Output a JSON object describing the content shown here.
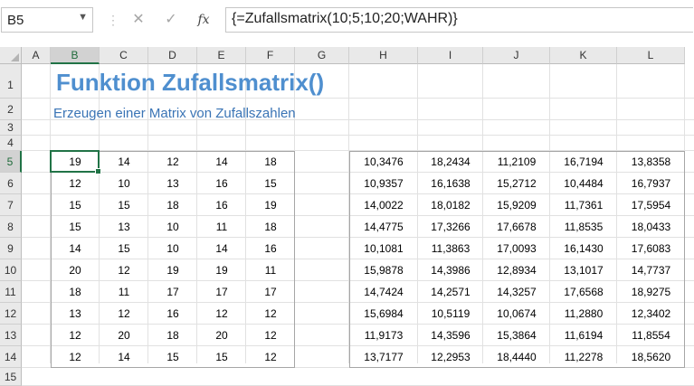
{
  "formula_bar": {
    "name_box": "B5",
    "formula": "{=Zufallsmatrix(10;5;10;20;WAHR)}",
    "icons": [
      "cancel-icon",
      "confirm-icon",
      "function-icon"
    ],
    "fx_label": "fx"
  },
  "columns": [
    "A",
    "B",
    "C",
    "D",
    "E",
    "F",
    "G",
    "H",
    "I",
    "J",
    "K",
    "L"
  ],
  "rows": [
    "1",
    "2",
    "3",
    "4",
    "5",
    "6",
    "7",
    "8",
    "9",
    "10",
    "11",
    "12",
    "13",
    "14",
    "15"
  ],
  "selected_column": "B",
  "selected_row": "5",
  "sheet": {
    "title": "Funktion Zufallsmatrix()",
    "subtitle": "Erzeugen einer Matrix von Zufallszahlen",
    "title_color": "#4f8fcf",
    "subtitle_color": "#3a74b5",
    "accent_color": "#217346",
    "integer_matrix": [
      [
        "19",
        "14",
        "12",
        "14",
        "18"
      ],
      [
        "12",
        "10",
        "13",
        "16",
        "15"
      ],
      [
        "15",
        "15",
        "18",
        "16",
        "19"
      ],
      [
        "15",
        "13",
        "10",
        "11",
        "18"
      ],
      [
        "14",
        "15",
        "10",
        "14",
        "16"
      ],
      [
        "20",
        "12",
        "19",
        "19",
        "11"
      ],
      [
        "18",
        "11",
        "17",
        "17",
        "17"
      ],
      [
        "13",
        "12",
        "16",
        "12",
        "12"
      ],
      [
        "12",
        "20",
        "18",
        "20",
        "12"
      ],
      [
        "12",
        "14",
        "15",
        "15",
        "12"
      ]
    ],
    "decimal_matrix": [
      [
        "10,3476",
        "18,2434",
        "11,2109",
        "16,7194",
        "13,8358"
      ],
      [
        "10,9357",
        "16,1638",
        "15,2712",
        "10,4484",
        "16,7937"
      ],
      [
        "14,0022",
        "18,0182",
        "15,9209",
        "11,7361",
        "17,5954"
      ],
      [
        "14,4775",
        "17,3266",
        "17,6678",
        "11,8535",
        "18,0433"
      ],
      [
        "10,1081",
        "11,3863",
        "17,0093",
        "16,1430",
        "17,6083"
      ],
      [
        "15,9878",
        "14,3986",
        "12,8934",
        "13,1017",
        "14,7737"
      ],
      [
        "14,7424",
        "14,2571",
        "14,3257",
        "17,6568",
        "18,9275"
      ],
      [
        "15,6984",
        "10,5119",
        "10,0674",
        "11,2880",
        "12,3402"
      ],
      [
        "11,9173",
        "14,3596",
        "15,3864",
        "11,6194",
        "11,8554"
      ],
      [
        "13,7177",
        "12,2953",
        "18,4440",
        "11,2278",
        "18,5620"
      ]
    ]
  }
}
